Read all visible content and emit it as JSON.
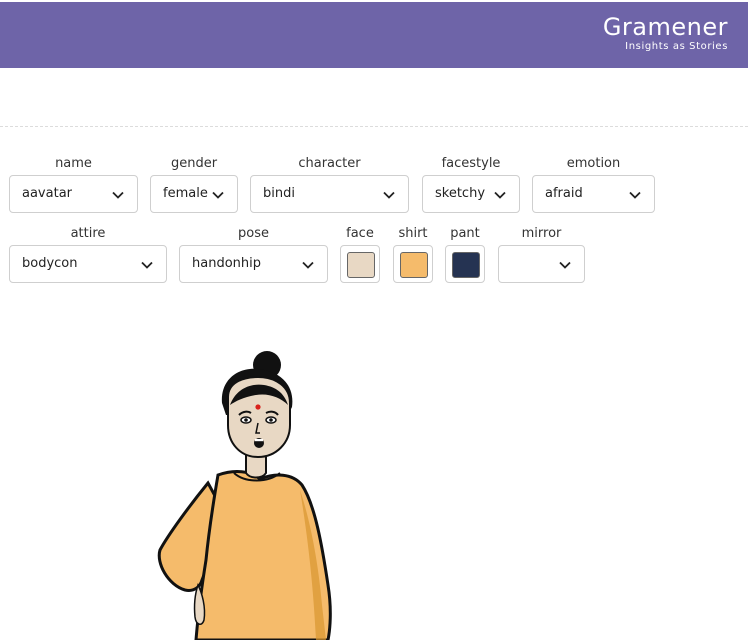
{
  "brand": {
    "name": "Gramener",
    "tagline": "Insights as Stories",
    "bar_color": "#6e64a8"
  },
  "controls": {
    "name": {
      "label": "name",
      "value": "aavatar"
    },
    "gender": {
      "label": "gender",
      "value": "female"
    },
    "character": {
      "label": "character",
      "value": "bindi"
    },
    "facestyle": {
      "label": "facestyle",
      "value": "sketchy"
    },
    "emotion": {
      "label": "emotion",
      "value": "afraid"
    },
    "attire": {
      "label": "attire",
      "value": "bodycon"
    },
    "pose": {
      "label": "pose",
      "value": "handonhip"
    },
    "face": {
      "label": "face",
      "color": "#e8d8c4"
    },
    "shirt": {
      "label": "shirt",
      "color": "#f5bb6b"
    },
    "pant": {
      "label": "pant",
      "color": "#253352"
    },
    "mirror": {
      "label": "mirror",
      "value": ""
    }
  },
  "avatar": {
    "skin": "#e8d8c4",
    "shirt": "#f5bb6b",
    "bindi": "#d9221c"
  }
}
